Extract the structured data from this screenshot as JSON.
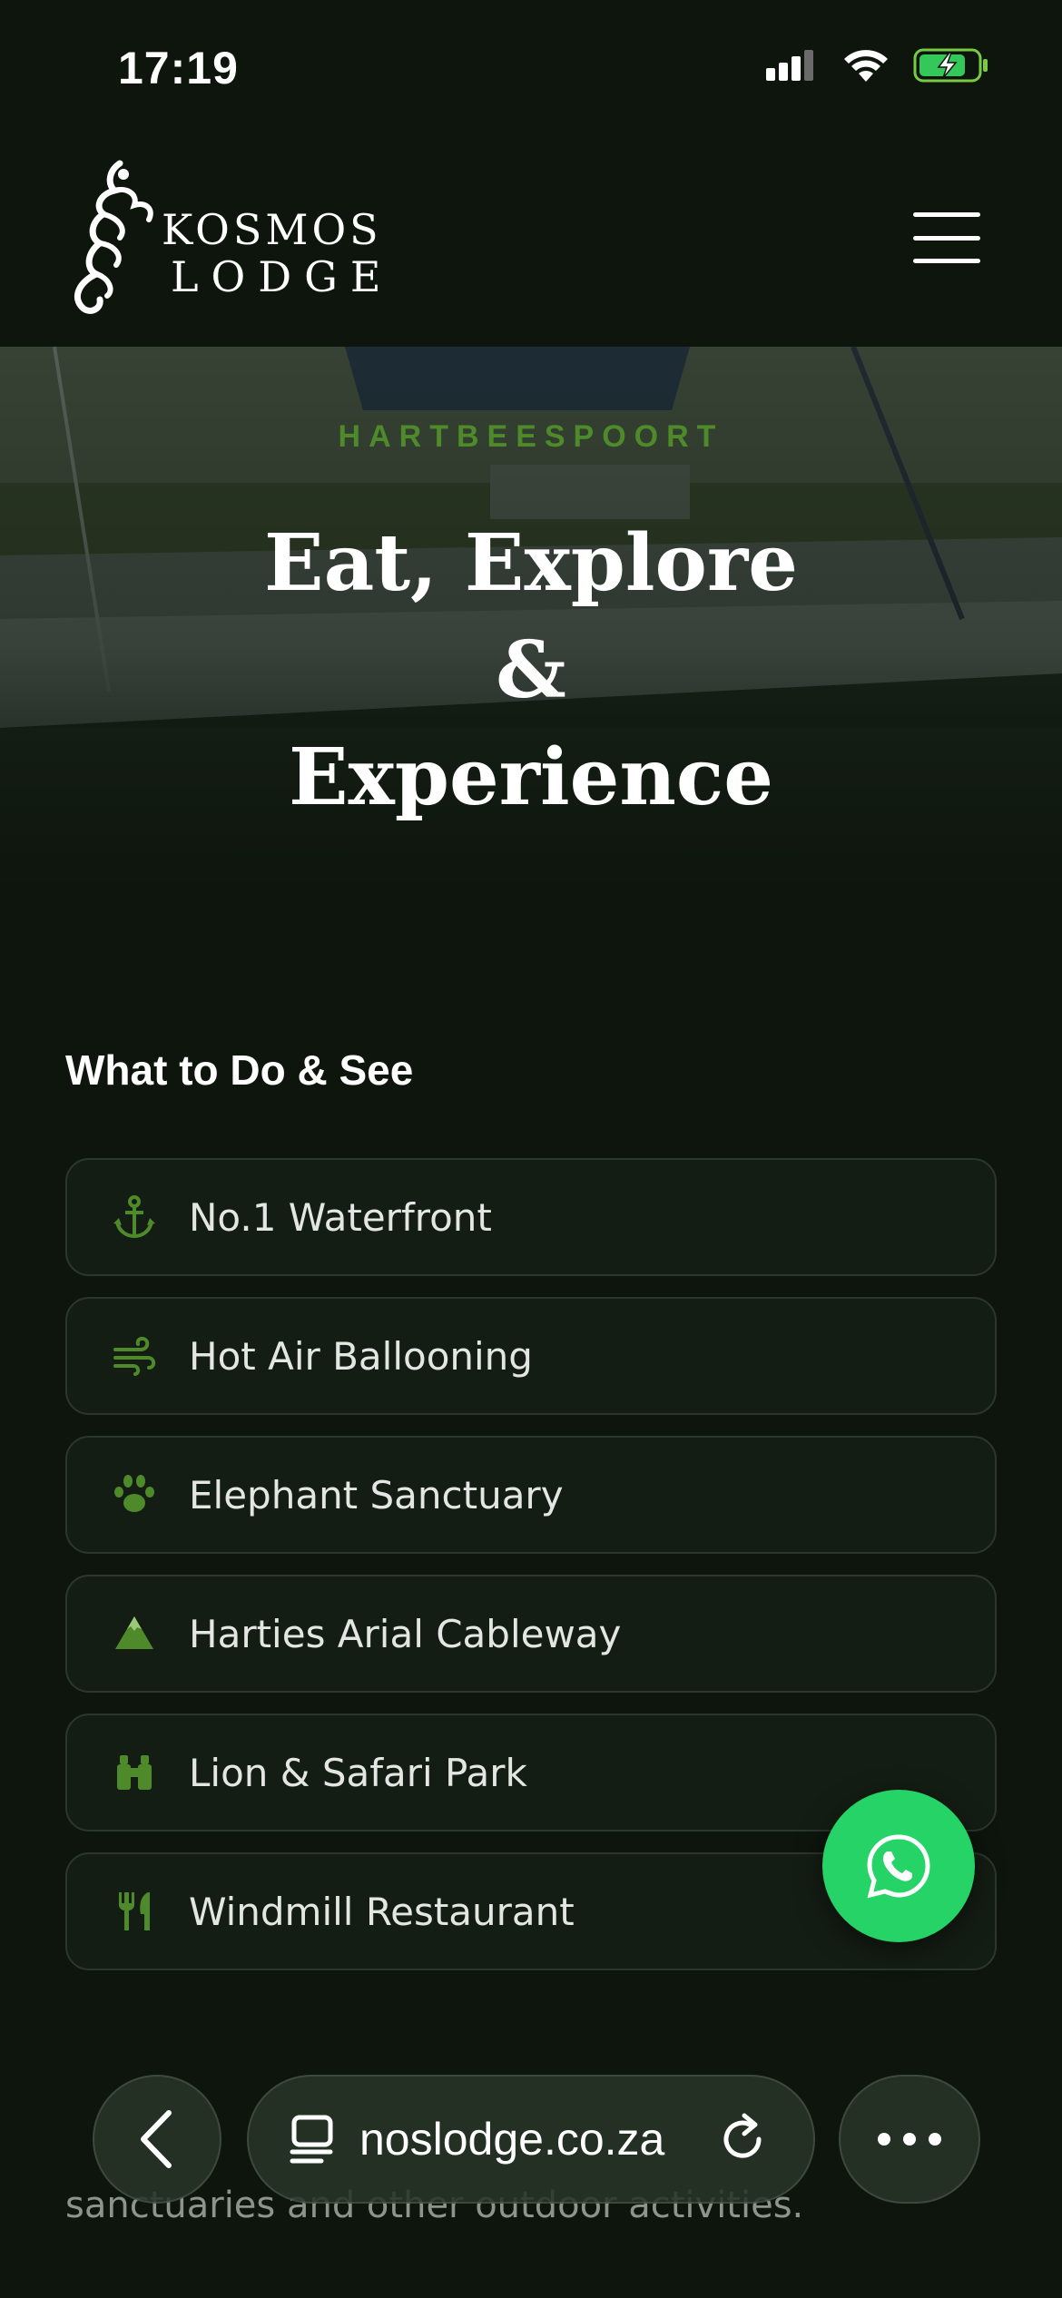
{
  "status_bar": {
    "time": "17:19",
    "icons": [
      "signal-icon",
      "wifi-icon",
      "battery-charging-icon"
    ]
  },
  "header": {
    "logo_line1": "KOSMOS",
    "logo_line2": "LODGE",
    "menu_icon": "hamburger-menu-icon"
  },
  "hero": {
    "kicker": "HARTBEESPOORT",
    "title": "Eat, Explore & Experience"
  },
  "section": {
    "title": "What to Do & See",
    "items": [
      {
        "label": "No.1 Waterfront",
        "icon": "anchor-icon"
      },
      {
        "label": "Hot Air Ballooning",
        "icon": "wind-icon"
      },
      {
        "label": "Elephant Sanctuary",
        "icon": "paw-icon"
      },
      {
        "label": "Harties Arial Cableway",
        "icon": "mountain-icon"
      },
      {
        "label": "Lion & Safari Park",
        "icon": "binoculars-icon"
      },
      {
        "label": "Windmill Restaurant",
        "icon": "utensils-icon"
      }
    ]
  },
  "paragraph": {
    "line3": "sanctuaries and other outdoor activities."
  },
  "browser": {
    "url": "noslodge.co.za"
  },
  "colors": {
    "background": "#0d150d",
    "accent_green": "#4e8a2a",
    "whatsapp_green": "#25d366"
  }
}
